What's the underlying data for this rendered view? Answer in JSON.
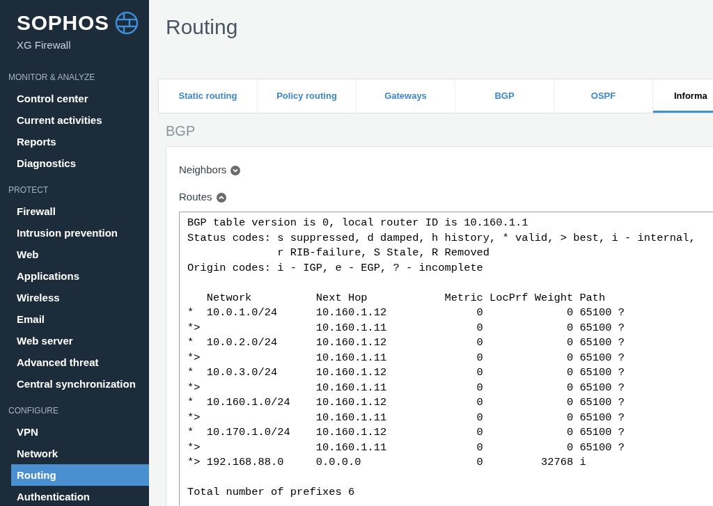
{
  "brand": {
    "name": "SOPHOS",
    "product": "XG Firewall"
  },
  "sidebar": {
    "sections": [
      {
        "title": "MONITOR & ANALYZE",
        "items": [
          {
            "label": "Control center",
            "selected": false
          },
          {
            "label": "Current activities",
            "selected": false
          },
          {
            "label": "Reports",
            "selected": false
          },
          {
            "label": "Diagnostics",
            "selected": false
          }
        ]
      },
      {
        "title": "PROTECT",
        "items": [
          {
            "label": "Firewall",
            "selected": false
          },
          {
            "label": "Intrusion prevention",
            "selected": false
          },
          {
            "label": "Web",
            "selected": false
          },
          {
            "label": "Applications",
            "selected": false
          },
          {
            "label": "Wireless",
            "selected": false
          },
          {
            "label": "Email",
            "selected": false
          },
          {
            "label": "Web server",
            "selected": false
          },
          {
            "label": "Advanced threat",
            "selected": false
          },
          {
            "label": "Central synchronization",
            "selected": false
          }
        ]
      },
      {
        "title": "CONFIGURE",
        "items": [
          {
            "label": "VPN",
            "selected": false
          },
          {
            "label": "Network",
            "selected": false
          },
          {
            "label": "Routing",
            "selected": true
          },
          {
            "label": "Authentication",
            "selected": false
          }
        ]
      }
    ]
  },
  "page_title": "Routing",
  "tabs": [
    {
      "label": "Static routing",
      "selected": false
    },
    {
      "label": "Policy routing",
      "selected": false
    },
    {
      "label": "Gateways",
      "selected": false
    },
    {
      "label": "BGP",
      "selected": false
    },
    {
      "label": "OSPF",
      "selected": false
    },
    {
      "label": "Informa",
      "selected": true
    }
  ],
  "section_title": "BGP",
  "panels": [
    {
      "label": "Neighbors",
      "expanded": false
    },
    {
      "label": "Routes",
      "expanded": true
    }
  ],
  "output_blocks": [
    [
      "BGP table version is 0, local router ID is 10.160.1.1",
      "Status codes: s suppressed, d damped, h history, * valid, > best, i - internal,",
      "              r RIB-failure, S Stale, R Removed",
      "Origin codes: i - IGP, e - EGP, ? - incomplete"
    ],
    [
      "   Network          Next Hop            Metric LocPrf Weight Path",
      "*  10.0.1.0/24      10.160.1.12              0             0 65100 ?",
      "*>                  10.160.1.11              0             0 65100 ?",
      "*  10.0.2.0/24      10.160.1.12              0             0 65100 ?",
      "*>                  10.160.1.11              0             0 65100 ?",
      "*  10.0.3.0/24      10.160.1.12              0             0 65100 ?",
      "*>                  10.160.1.11              0             0 65100 ?",
      "*  10.160.1.0/24    10.160.1.12              0             0 65100 ?",
      "*>                  10.160.1.11              0             0 65100 ?",
      "*  10.170.1.0/24    10.160.1.12              0             0 65100 ?",
      "*>                  10.160.1.11              0             0 65100 ?",
      "*> 192.168.88.0     0.0.0.0                  0         32768 i"
    ],
    [
      "Total number of prefixes 6"
    ]
  ]
}
